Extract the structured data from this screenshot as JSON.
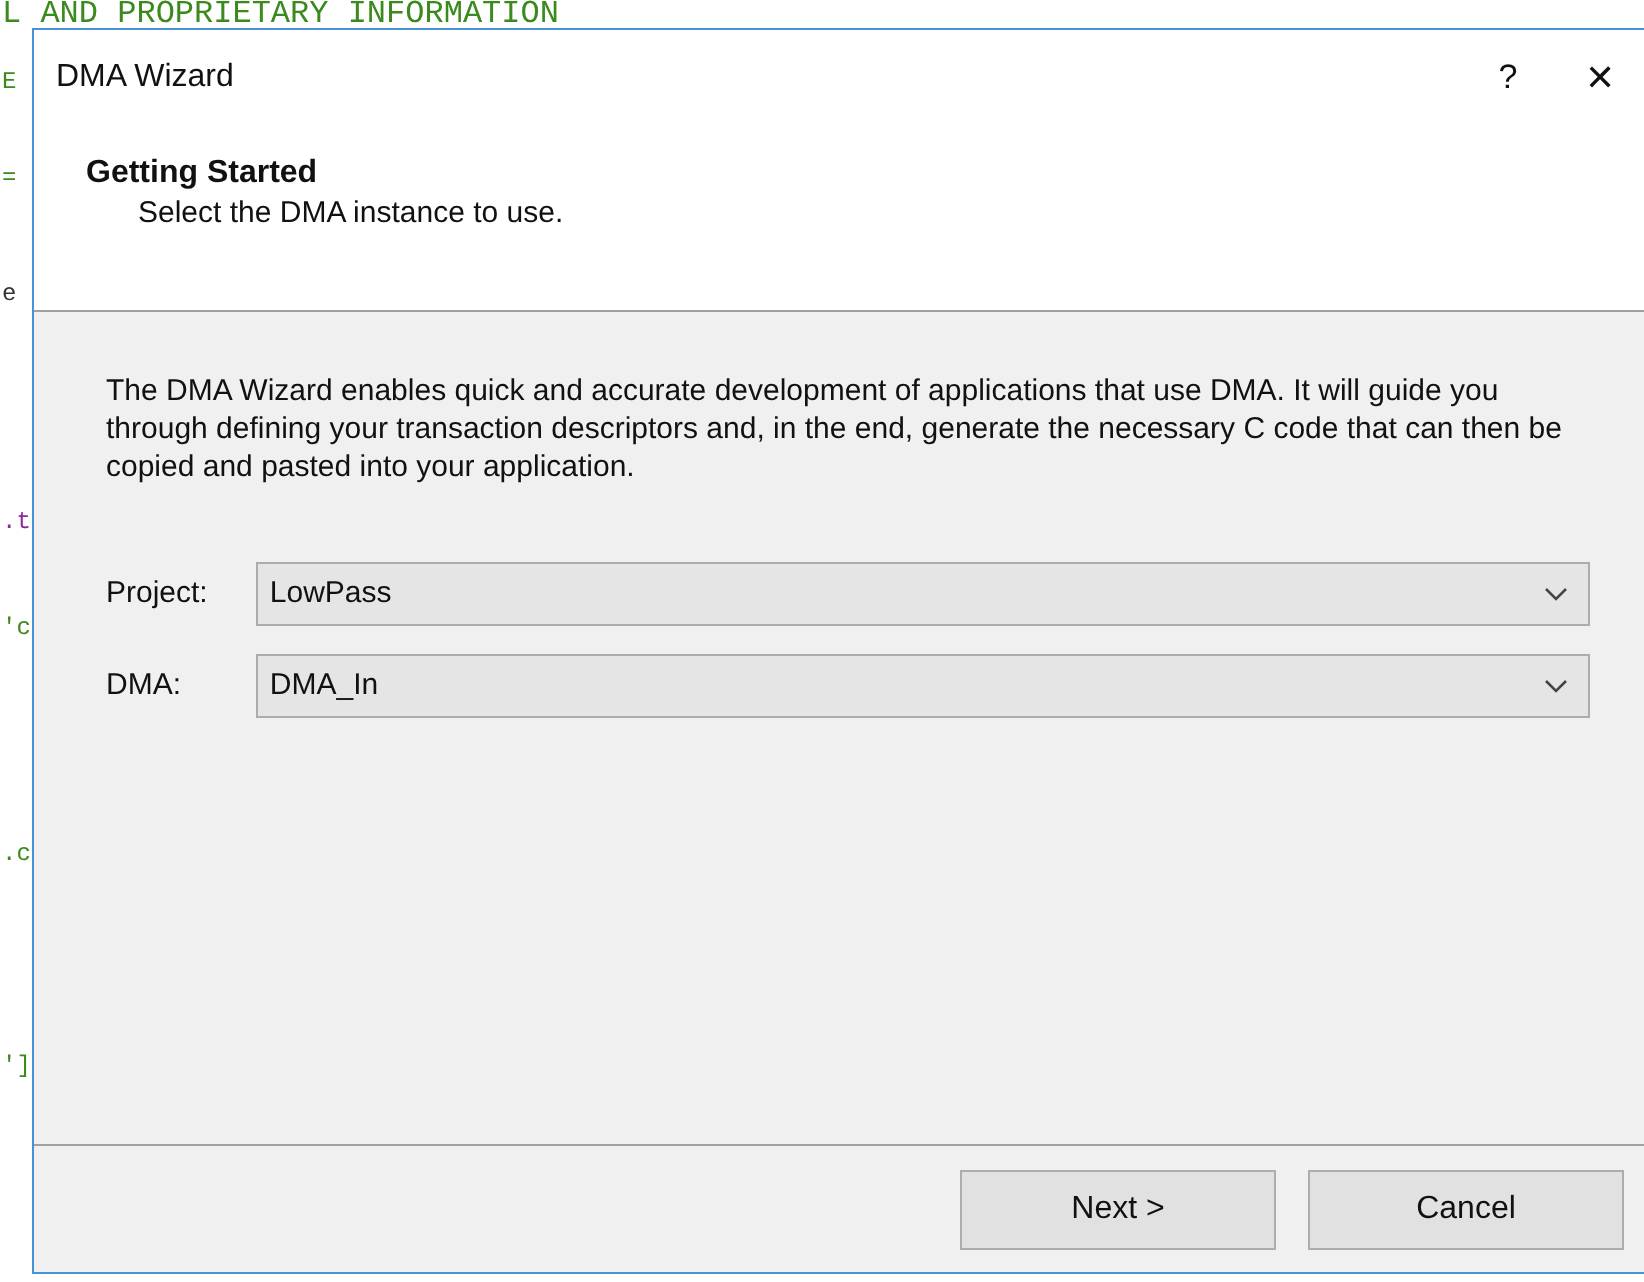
{
  "editor_background": {
    "lines": [
      {
        "text": "L AND PROPRIETARY INFORMATION",
        "color": "#3a8a1e"
      },
      {
        "text": "E",
        "color": "#3a8a1e"
      },
      {
        "text": "=",
        "color": "#3a8a1e"
      },
      {
        "text": "e",
        "color": "#333333"
      },
      {
        "text": ".t",
        "color": "#8a2b9a"
      },
      {
        "text": "'c",
        "color": "#3a8a1e"
      },
      {
        "text": ".c",
        "color": "#3a8a1e"
      },
      {
        "text": "']",
        "color": "#3a8a1e"
      }
    ]
  },
  "window": {
    "title": "DMA Wizard",
    "help": "?",
    "close": "✕"
  },
  "header": {
    "title": "Getting Started",
    "subtitle": "Select the DMA instance to use."
  },
  "description": "The DMA Wizard enables quick and accurate development of applications that use DMA. It will guide you through defining your transaction descriptors and, in the end, generate the necessary C code that can then be copied and pasted into your application.",
  "fields": [
    {
      "label": "Project:",
      "value": "LowPass"
    },
    {
      "label": "DMA:",
      "value": "DMA_In"
    }
  ],
  "buttons": [
    "Next >",
    "Cancel"
  ]
}
